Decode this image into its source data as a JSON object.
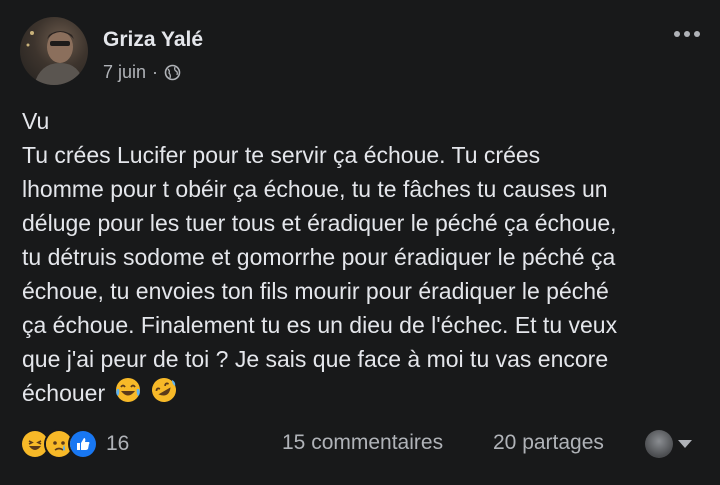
{
  "author": {
    "name": "Griza Yalé",
    "date": "7 juin",
    "separator": "·",
    "audience_icon": "globe-icon"
  },
  "menu_icon": "more-options-icon",
  "post": {
    "lines": [
      "Vu",
      "Tu crées Lucifer pour te servir ça échoue. Tu crées",
      "lhomme pour t obéir ça échoue, tu te fâches tu causes un",
      "déluge pour les tuer tous et éradiquer le péché ça échoue,",
      "tu détruis sodome et gomorrhe pour éradiquer le péché ça",
      "échoue, tu envoies ton fils mourir pour éradiquer le péché",
      "ça échoue. Finalement tu es un dieu de l'échec. Et tu veux",
      "que j'ai peur de toi ? Je sais que face à moi tu vas encore",
      "échouer"
    ],
    "emojis": [
      "tears-of-joy-emoji-icon",
      "rofl-emoji-icon"
    ]
  },
  "footer": {
    "reactions": [
      "haha-reaction-icon",
      "sad-reaction-icon",
      "like-reaction-icon"
    ],
    "reaction_count": "16",
    "comments": "15 commentaires",
    "shares": "20 partages"
  },
  "colors": {
    "background": "#18191a",
    "primary_text": "#e4e6eb",
    "secondary_text": "#b0b3b8",
    "like_blue": "#1877f2",
    "emoji_yellow": "#f7b928"
  }
}
